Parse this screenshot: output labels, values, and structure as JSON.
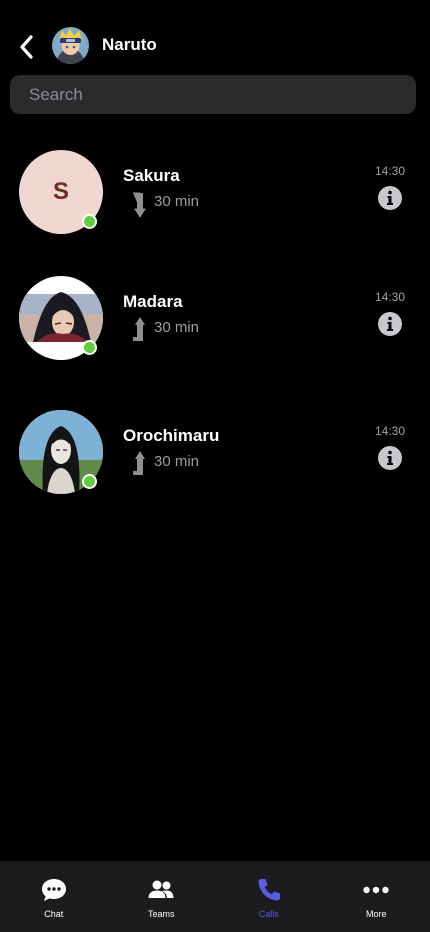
{
  "header": {
    "title": "Naruto",
    "back_icon": "chevron-left-icon",
    "avatar": "naruto-avatar-image"
  },
  "search": {
    "placeholder": "Search",
    "value": ""
  },
  "calls": [
    {
      "name": "Sakura",
      "initial": "S",
      "direction": "incoming",
      "direction_icon": "arrow-down-icon",
      "duration": "30 min",
      "time": "14:30",
      "online": true,
      "info_icon": "info-icon"
    },
    {
      "name": "Madara",
      "initial": "",
      "direction": "outgoing",
      "direction_icon": "arrow-up-icon",
      "duration": "30 min",
      "time": "14:30",
      "online": true,
      "info_icon": "info-icon"
    },
    {
      "name": "Orochimaru",
      "initial": "",
      "direction": "outgoing",
      "direction_icon": "arrow-up-icon",
      "duration": "30 min",
      "time": "14:30",
      "online": true,
      "info_icon": "info-icon"
    }
  ],
  "tabbar": {
    "active": "Calls",
    "tabs": [
      {
        "label": "Chat",
        "icon": "chat-bubble-icon"
      },
      {
        "label": "Teams",
        "icon": "people-icon"
      },
      {
        "label": "Calls",
        "icon": "phone-icon"
      },
      {
        "label": "More",
        "icon": "more-dots-icon"
      }
    ]
  },
  "colors": {
    "background": "#000000",
    "search_bg": "#2b2b2e",
    "tabbar_bg": "#1c1c1e",
    "accent": "#5d5ce6",
    "online": "#5fcf3f",
    "initial_avatar_bg": "#f0d8d1",
    "initial_avatar_text": "#6b2f26"
  }
}
